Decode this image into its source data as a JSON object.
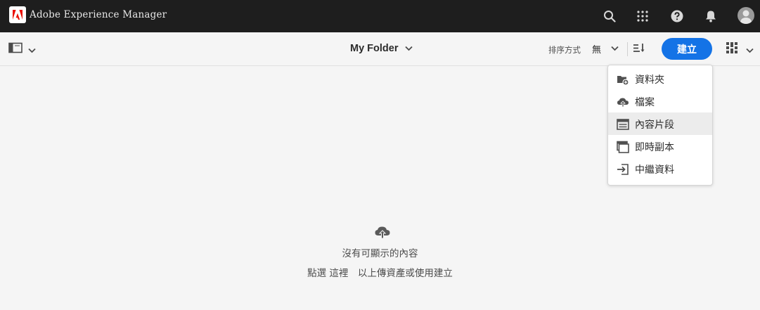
{
  "topbar": {
    "app_title": "Adobe Experience Manager",
    "icons": [
      "search-icon",
      "apps-grid-icon",
      "help-icon",
      "notifications-bell-icon",
      "user-avatar"
    ]
  },
  "actionbar": {
    "folder_title": "My Folder",
    "sort_label": "排序方式",
    "sort_value": "無",
    "create_label": "建立"
  },
  "create_menu": {
    "items": [
      {
        "label": "資料夾",
        "icon": "folder-add-icon"
      },
      {
        "label": "檔案",
        "icon": "upload-cloud-icon"
      },
      {
        "label": "內容片段",
        "icon": "content-fragment-icon"
      },
      {
        "label": "即時副本",
        "icon": "live-copy-icon"
      },
      {
        "label": "中繼資料",
        "icon": "metadata-import-icon"
      }
    ]
  },
  "empty_state": {
    "icon": "upload-cloud-icon",
    "title": "沒有可顯示的內容",
    "subtitle": "點選 這裡　以上傳資產或使用建立"
  },
  "colors": {
    "topbar_bg": "#1e1e1e",
    "accent": "#1473e6",
    "brand_red": "#eb1000"
  }
}
